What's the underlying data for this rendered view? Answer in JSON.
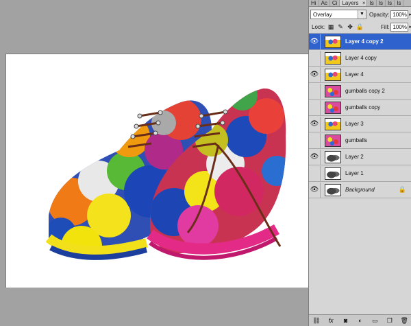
{
  "panel_tabs": [
    "Hi",
    "Ac",
    "Ci",
    "Layers",
    "Is",
    "Is",
    "Is",
    "Is"
  ],
  "active_tab_close": "×",
  "blend_mode": "Overlay",
  "opacity_label": "Opacity:",
  "opacity_value": "100%",
  "lock_label": "Lock:",
  "fill_label": "Fill:",
  "fill_value": "100%",
  "layers": [
    {
      "name": "Layer 4 copy 2",
      "visible": true,
      "selected": true,
      "thumb": "gumballs-shoe"
    },
    {
      "name": "Layer 4 copy",
      "visible": false,
      "selected": false,
      "thumb": "gumballs-shoe"
    },
    {
      "name": "Layer 4",
      "visible": true,
      "selected": false,
      "thumb": "gumballs-shoe"
    },
    {
      "name": "gumballs copy 2",
      "visible": false,
      "selected": false,
      "thumb": "gumballs"
    },
    {
      "name": "gumballs copy",
      "visible": false,
      "selected": false,
      "thumb": "gumballs"
    },
    {
      "name": "Layer 3",
      "visible": true,
      "selected": false,
      "thumb": "gumballs-shoe"
    },
    {
      "name": "gumballs",
      "visible": false,
      "selected": false,
      "thumb": "gumballs"
    },
    {
      "name": "Layer 2",
      "visible": true,
      "selected": false,
      "thumb": "shoe"
    },
    {
      "name": "Layer 1",
      "visible": false,
      "selected": false,
      "thumb": "shoe"
    },
    {
      "name": "Background",
      "visible": true,
      "selected": false,
      "thumb": "shoe",
      "locked": true
    }
  ],
  "icons": {
    "eye": "eye-icon",
    "lock": "lock-icon",
    "link": "link-layers-icon",
    "fx": "layer-style-icon",
    "mask": "add-mask-icon",
    "adjust": "adjustment-layer-icon",
    "group": "new-group-icon",
    "new": "new-layer-icon",
    "trash": "delete-layer-icon"
  },
  "colors": {
    "selection": "#2f62cc",
    "panel": "#d6d6d6",
    "workspace": "#a2a2a2"
  }
}
